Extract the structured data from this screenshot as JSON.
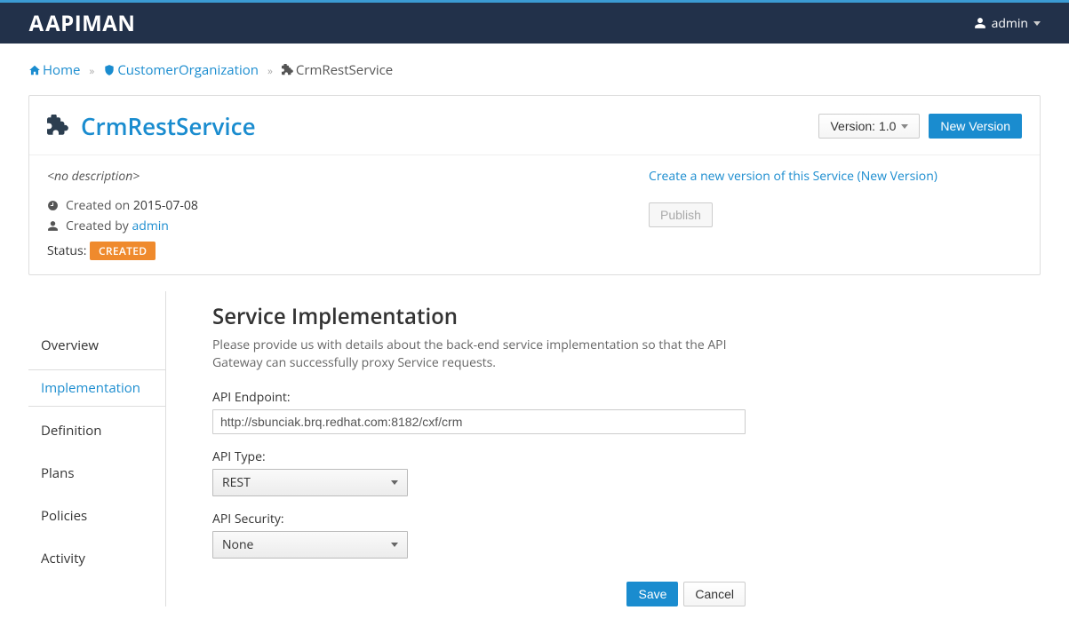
{
  "nav": {
    "brand": "APIMAN",
    "user": "admin"
  },
  "breadcrumbs": {
    "home": "Home",
    "org": "CustomerOrganization",
    "current": "CrmRestService"
  },
  "service": {
    "name": "CrmRestService",
    "no_description": "<no description>",
    "created_on_label": "Created on",
    "created_on": "2015-07-08",
    "created_by_label": "Created by",
    "created_by": "admin",
    "status_label": "Status:",
    "status_badge": "CREATED",
    "version_btn": "Version: 1.0",
    "new_version_btn": "New Version",
    "help_link": "Create a new version of this Service (New Version)",
    "publish_btn": "Publish"
  },
  "tabs": {
    "overview": "Overview",
    "implementation": "Implementation",
    "definition": "Definition",
    "plans": "Plans",
    "policies": "Policies",
    "activity": "Activity"
  },
  "impl": {
    "heading": "Service Implementation",
    "blurb": "Please provide us with details about the back-end service implementation so that the API Gateway can successfully proxy Service requests.",
    "endpoint_label": "API Endpoint:",
    "endpoint_value": "http://sbunciak.brq.redhat.com:8182/cxf/crm",
    "type_label": "API Type:",
    "type_value": "REST",
    "security_label": "API Security:",
    "security_value": "None",
    "save": "Save",
    "cancel": "Cancel"
  }
}
